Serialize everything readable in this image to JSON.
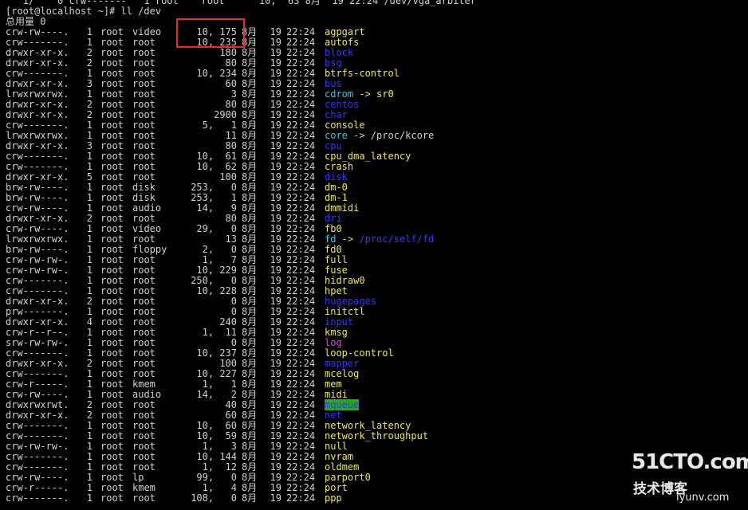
{
  "terminal": {
    "top_partial": "   1/    0 crw-------   1 root    root      10,  63 8月  19 22:24 /dev/vga_arbiter",
    "prompt": "[root@localhost ~]# ll /dev",
    "total": "总用量 0",
    "highlight_color": "#e03030"
  },
  "colors": {
    "file": "#ece85a",
    "dir": "#3535ff",
    "link": "#38c8e0",
    "socket": "#d44fd4",
    "sticky_bg": "#29a329"
  },
  "entries": [
    {
      "perm": "crw-rw----.",
      "links": "1",
      "owner": "root",
      "group": "video",
      "size": "10, 175",
      "month": "8月",
      "day": "19",
      "time": "22:24",
      "name": "agpgart",
      "type": "file"
    },
    {
      "perm": "crw-------.",
      "links": "1",
      "owner": "root",
      "group": "root",
      "size": "10, 235",
      "month": "8月",
      "day": "19",
      "time": "22:24",
      "name": "autofs",
      "type": "file"
    },
    {
      "perm": "drwxr-xr-x.",
      "links": "2",
      "owner": "root",
      "group": "root",
      "size": "180",
      "month": "8月",
      "day": "19",
      "time": "22:24",
      "name": "block",
      "type": "dir"
    },
    {
      "perm": "drwxr-xr-x.",
      "links": "2",
      "owner": "root",
      "group": "root",
      "size": "80",
      "month": "8月",
      "day": "19",
      "time": "22:24",
      "name": "bsg",
      "type": "dir"
    },
    {
      "perm": "crw-------.",
      "links": "1",
      "owner": "root",
      "group": "root",
      "size": "10, 234",
      "month": "8月",
      "day": "19",
      "time": "22:24",
      "name": "btrfs-control",
      "type": "file"
    },
    {
      "perm": "drwxr-xr-x.",
      "links": "3",
      "owner": "root",
      "group": "root",
      "size": "60",
      "month": "8月",
      "day": "19",
      "time": "22:24",
      "name": "bus",
      "type": "dir"
    },
    {
      "perm": "lrwxrwxrwx.",
      "links": "1",
      "owner": "root",
      "group": "root",
      "size": "3",
      "month": "8月",
      "day": "19",
      "time": "22:24",
      "name": "cdrom",
      "type": "link",
      "target": " -> sr0",
      "target_type": "file"
    },
    {
      "perm": "drwxr-xr-x.",
      "links": "2",
      "owner": "root",
      "group": "root",
      "size": "80",
      "month": "8月",
      "day": "19",
      "time": "22:24",
      "name": "centos",
      "type": "dir"
    },
    {
      "perm": "drwxr-xr-x.",
      "links": "2",
      "owner": "root",
      "group": "root",
      "size": "2900",
      "month": "8月",
      "day": "19",
      "time": "22:24",
      "name": "char",
      "type": "dir"
    },
    {
      "perm": "crw-------.",
      "links": "1",
      "owner": "root",
      "group": "root",
      "size": "5,   1",
      "month": "8月",
      "day": "19",
      "time": "22:24",
      "name": "console",
      "type": "file"
    },
    {
      "perm": "lrwxrwxrwx.",
      "links": "1",
      "owner": "root",
      "group": "root",
      "size": "11",
      "month": "8月",
      "day": "19",
      "time": "22:24",
      "name": "core",
      "type": "link",
      "target": " -> /proc/kcore",
      "target_type": "plain"
    },
    {
      "perm": "drwxr-xr-x.",
      "links": "3",
      "owner": "root",
      "group": "root",
      "size": "80",
      "month": "8月",
      "day": "19",
      "time": "22:24",
      "name": "cpu",
      "type": "dir"
    },
    {
      "perm": "crw-------.",
      "links": "1",
      "owner": "root",
      "group": "root",
      "size": "10,  61",
      "month": "8月",
      "day": "19",
      "time": "22:24",
      "name": "cpu_dma_latency",
      "type": "file"
    },
    {
      "perm": "crw-------.",
      "links": "1",
      "owner": "root",
      "group": "root",
      "size": "10,  62",
      "month": "8月",
      "day": "19",
      "time": "22:24",
      "name": "crash",
      "type": "file"
    },
    {
      "perm": "drwxr-xr-x.",
      "links": "5",
      "owner": "root",
      "group": "root",
      "size": "100",
      "month": "8月",
      "day": "19",
      "time": "22:24",
      "name": "disk",
      "type": "dir"
    },
    {
      "perm": "brw-rw----.",
      "links": "1",
      "owner": "root",
      "group": "disk",
      "size": "253,   0",
      "month": "8月",
      "day": "19",
      "time": "22:24",
      "name": "dm-0",
      "type": "file"
    },
    {
      "perm": "brw-rw----.",
      "links": "1",
      "owner": "root",
      "group": "disk",
      "size": "253,   1",
      "month": "8月",
      "day": "19",
      "time": "22:24",
      "name": "dm-1",
      "type": "file"
    },
    {
      "perm": "crw-rw----.",
      "links": "1",
      "owner": "root",
      "group": "audio",
      "size": "14,   9",
      "month": "8月",
      "day": "19",
      "time": "22:24",
      "name": "dmmidi",
      "type": "file"
    },
    {
      "perm": "drwxr-xr-x.",
      "links": "2",
      "owner": "root",
      "group": "root",
      "size": "80",
      "month": "8月",
      "day": "19",
      "time": "22:24",
      "name": "dri",
      "type": "dir"
    },
    {
      "perm": "crw-rw----.",
      "links": "1",
      "owner": "root",
      "group": "video",
      "size": "29,   0",
      "month": "8月",
      "day": "19",
      "time": "22:24",
      "name": "fb0",
      "type": "file"
    },
    {
      "perm": "lrwxrwxrwx.",
      "links": "1",
      "owner": "root",
      "group": "root",
      "size": "13",
      "month": "8月",
      "day": "19",
      "time": "22:24",
      "name": "fd",
      "type": "link",
      "target_prefix": " -> ",
      "target": "/proc/self/fd",
      "target_type": "dir"
    },
    {
      "perm": "brw-rw----.",
      "links": "1",
      "owner": "root",
      "group": "floppy",
      "size": "2,   0",
      "month": "8月",
      "day": "19",
      "time": "22:24",
      "name": "fd0",
      "type": "file"
    },
    {
      "perm": "crw-rw-rw-.",
      "links": "1",
      "owner": "root",
      "group": "root",
      "size": "1,   7",
      "month": "8月",
      "day": "19",
      "time": "22:24",
      "name": "full",
      "type": "file"
    },
    {
      "perm": "crw-rw-rw-.",
      "links": "1",
      "owner": "root",
      "group": "root",
      "size": "10, 229",
      "month": "8月",
      "day": "19",
      "time": "22:24",
      "name": "fuse",
      "type": "file"
    },
    {
      "perm": "crw-------.",
      "links": "1",
      "owner": "root",
      "group": "root",
      "size": "250,   0",
      "month": "8月",
      "day": "19",
      "time": "22:24",
      "name": "hidraw0",
      "type": "file"
    },
    {
      "perm": "crw-------.",
      "links": "1",
      "owner": "root",
      "group": "root",
      "size": "10, 228",
      "month": "8月",
      "day": "19",
      "time": "22:24",
      "name": "hpet",
      "type": "file"
    },
    {
      "perm": "drwxr-xr-x.",
      "links": "2",
      "owner": "root",
      "group": "root",
      "size": "0",
      "month": "8月",
      "day": "19",
      "time": "22:24",
      "name": "hugepages",
      "type": "dir"
    },
    {
      "perm": "prw-------.",
      "links": "1",
      "owner": "root",
      "group": "root",
      "size": "0",
      "month": "8月",
      "day": "19",
      "time": "22:24",
      "name": "initctl",
      "type": "file"
    },
    {
      "perm": "drwxr-xr-x.",
      "links": "4",
      "owner": "root",
      "group": "root",
      "size": "240",
      "month": "8月",
      "day": "19",
      "time": "22:24",
      "name": "input",
      "type": "dir"
    },
    {
      "perm": "crw-r--r--.",
      "links": "1",
      "owner": "root",
      "group": "root",
      "size": "1,  11",
      "month": "8月",
      "day": "19",
      "time": "22:24",
      "name": "kmsg",
      "type": "file"
    },
    {
      "perm": "srw-rw-rw-.",
      "links": "1",
      "owner": "root",
      "group": "root",
      "size": "0",
      "month": "8月",
      "day": "19",
      "time": "22:24",
      "name": "log",
      "type": "socket"
    },
    {
      "perm": "crw-------.",
      "links": "1",
      "owner": "root",
      "group": "root",
      "size": "10, 237",
      "month": "8月",
      "day": "19",
      "time": "22:24",
      "name": "loop-control",
      "type": "file"
    },
    {
      "perm": "drwxr-xr-x.",
      "links": "2",
      "owner": "root",
      "group": "root",
      "size": "100",
      "month": "8月",
      "day": "19",
      "time": "22:24",
      "name": "mapper",
      "type": "dir"
    },
    {
      "perm": "crw-------.",
      "links": "1",
      "owner": "root",
      "group": "root",
      "size": "10, 227",
      "month": "8月",
      "day": "19",
      "time": "22:24",
      "name": "mcelog",
      "type": "file"
    },
    {
      "perm": "crw-r-----.",
      "links": "1",
      "owner": "root",
      "group": "kmem",
      "size": "1,   1",
      "month": "8月",
      "day": "19",
      "time": "22:24",
      "name": "mem",
      "type": "file"
    },
    {
      "perm": "crw-rw----.",
      "links": "1",
      "owner": "root",
      "group": "audio",
      "size": "14,   2",
      "month": "8月",
      "day": "19",
      "time": "22:24",
      "name": "midi",
      "type": "file"
    },
    {
      "perm": "drwxrwxrwt.",
      "links": "2",
      "owner": "root",
      "group": "root",
      "size": "40",
      "month": "8月",
      "day": "19",
      "time": "22:24",
      "name": "mqueue",
      "type": "sticky"
    },
    {
      "perm": "drwxr-xr-x.",
      "links": "2",
      "owner": "root",
      "group": "root",
      "size": "60",
      "month": "8月",
      "day": "19",
      "time": "22:24",
      "name": "net",
      "type": "dir"
    },
    {
      "perm": "crw-------.",
      "links": "1",
      "owner": "root",
      "group": "root",
      "size": "10,  60",
      "month": "8月",
      "day": "19",
      "time": "22:24",
      "name": "network_latency",
      "type": "file"
    },
    {
      "perm": "crw-------.",
      "links": "1",
      "owner": "root",
      "group": "root",
      "size": "10,  59",
      "month": "8月",
      "day": "19",
      "time": "22:24",
      "name": "network_throughput",
      "type": "file"
    },
    {
      "perm": "crw-rw-rw-.",
      "links": "1",
      "owner": "root",
      "group": "root",
      "size": "1,   3",
      "month": "8月",
      "day": "19",
      "time": "22:24",
      "name": "null",
      "type": "file"
    },
    {
      "perm": "crw-------.",
      "links": "1",
      "owner": "root",
      "group": "root",
      "size": "10, 144",
      "month": "8月",
      "day": "19",
      "time": "22:24",
      "name": "nvram",
      "type": "file"
    },
    {
      "perm": "crw-------.",
      "links": "1",
      "owner": "root",
      "group": "root",
      "size": "1,  12",
      "month": "8月",
      "day": "19",
      "time": "22:24",
      "name": "oldmem",
      "type": "file"
    },
    {
      "perm": "crw-rw----.",
      "links": "1",
      "owner": "root",
      "group": "lp",
      "size": "99,   0",
      "month": "8月",
      "day": "19",
      "time": "22:24",
      "name": "parport0",
      "type": "file"
    },
    {
      "perm": "crw-r-----.",
      "links": "1",
      "owner": "root",
      "group": "kmem",
      "size": "1,   4",
      "month": "8月",
      "day": "19",
      "time": "22:24",
      "name": "port",
      "type": "file"
    },
    {
      "perm": "crw-------.",
      "links": "1",
      "owner": "root",
      "group": "root",
      "size": "108,   0",
      "month": "8月",
      "day": "19",
      "time": "22:24",
      "name": "ppp",
      "type": "file"
    }
  ],
  "watermark": {
    "brand": "51CTO.com",
    "sub": "技术博客",
    "url": "iyunv.com"
  }
}
